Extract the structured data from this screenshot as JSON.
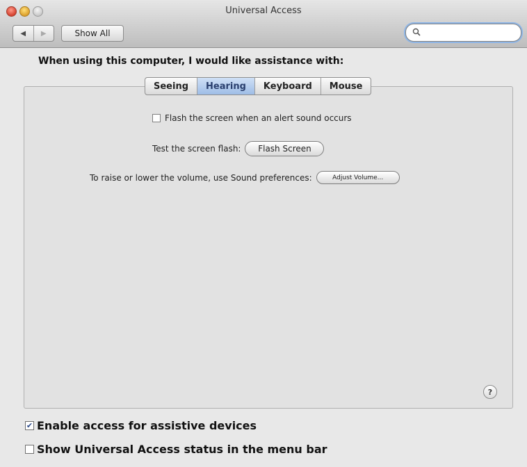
{
  "window": {
    "title": "Universal Access"
  },
  "toolbar": {
    "back_icon": "◀",
    "forward_icon": "▶",
    "show_all_label": "Show All",
    "search_icon": "🔍",
    "search_value": ""
  },
  "main": {
    "heading": "When using this computer, I would like assistance with:",
    "tabs": [
      {
        "label": "Seeing",
        "active": false
      },
      {
        "label": "Hearing",
        "active": true
      },
      {
        "label": "Keyboard",
        "active": false
      },
      {
        "label": "Mouse",
        "active": false
      }
    ],
    "hearing": {
      "flash_checkbox_label": "Flash the screen when an alert sound occurs",
      "flash_checkbox_checked": false,
      "test_flash_label": "Test the screen flash:",
      "flash_button_label": "Flash Screen",
      "volume_label": "To raise or lower the volume, use Sound preferences:",
      "adjust_volume_label": "Adjust Volume..."
    },
    "help_label": "?"
  },
  "bottom": {
    "assistive_label": "Enable access for assistive devices",
    "assistive_checked": true,
    "assistive_check_glyph": "✔",
    "status_label": "Show Universal Access status in the menu bar",
    "status_checked": false
  },
  "colors": {
    "accent": "#9ebde6",
    "search_focus": "#8fb6e6"
  }
}
